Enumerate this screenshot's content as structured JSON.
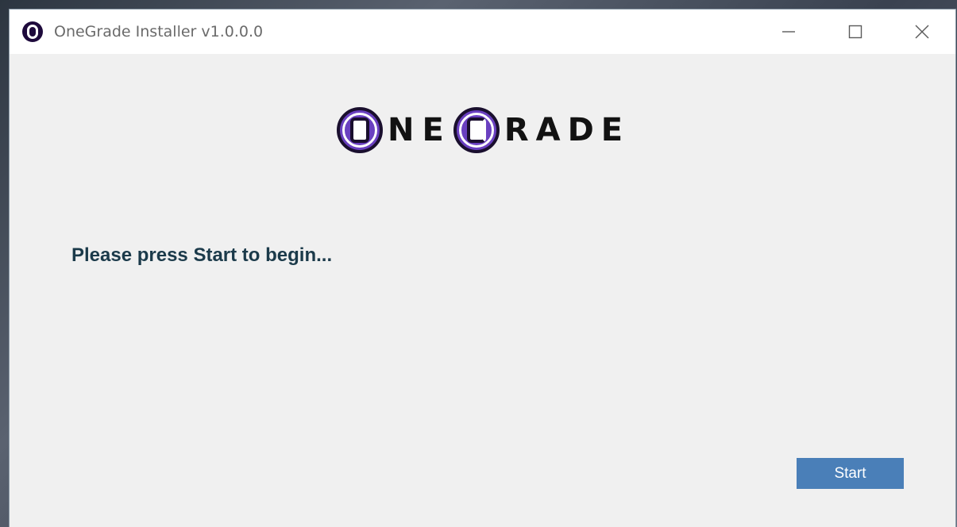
{
  "window": {
    "title": "OneGrade Installer v1.0.0.0",
    "app_icon": "onegrade-o-icon",
    "caption_buttons": [
      {
        "name": "minimize",
        "icon": "minimize-icon"
      },
      {
        "name": "maximize",
        "icon": "maximize-icon"
      },
      {
        "name": "close",
        "icon": "close-icon"
      }
    ]
  },
  "logo": {
    "text": "OneGrade",
    "part1_letters": "NE",
    "part2_letters": "RADE",
    "accent_color": "#6a40c0"
  },
  "main": {
    "status_message": "Please press Start to begin...",
    "start_label": "Start"
  },
  "colors": {
    "status_text": "#1b3a4a",
    "button_bg": "#4a7fb8",
    "window_bg": "#f0f0f0"
  }
}
